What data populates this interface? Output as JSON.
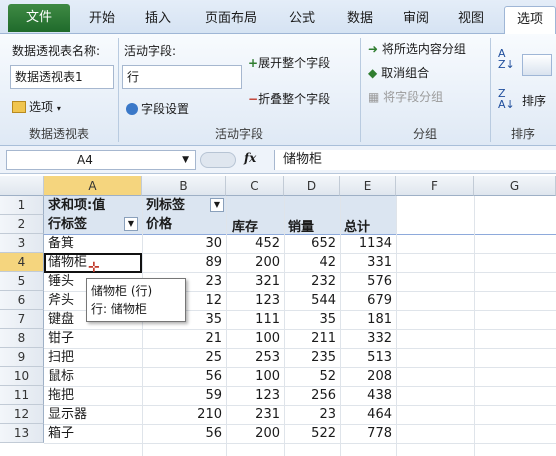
{
  "tabs": [
    "文件",
    "开始",
    "插入",
    "页面布局",
    "公式",
    "数据",
    "审阅",
    "视图",
    "选项"
  ],
  "ribbon": {
    "pivot_group": {
      "name_label": "数据透视表名称:",
      "name_value": "数据透视表1",
      "options_label": "选项",
      "group_label": "数据透视表"
    },
    "field_group": {
      "field_label": "活动字段:",
      "field_value": "行",
      "field_settings": "字段设置",
      "expand_label": "展开整个字段",
      "collapse_label": "折叠整个字段",
      "group_label": "活动字段"
    },
    "grouping_group": {
      "group_selection": "将所选内容分组",
      "ungroup": "取消组合",
      "group_field": "将字段分组",
      "group_label": "分组"
    },
    "sort_group": {
      "sort_label": "排序",
      "group_label": "排序"
    }
  },
  "formula_bar": {
    "cell_ref": "A4",
    "fx": "fx",
    "content": "储物柜"
  },
  "columns": [
    "A",
    "B",
    "C",
    "D",
    "E",
    "F",
    "G"
  ],
  "rows": [
    {
      "n": "1",
      "a": "求和项:值",
      "b": "列标签",
      "c": "",
      "d": "",
      "e": ""
    },
    {
      "n": "2",
      "a": "行标签",
      "b": "价格",
      "c": "库存",
      "d": "销量",
      "e": "总计"
    },
    {
      "n": "3",
      "a": "备箕",
      "b": "30",
      "c": "452",
      "d": "652",
      "e": "1134"
    },
    {
      "n": "4",
      "a": "储物柜",
      "b": "89",
      "c": "200",
      "d": "42",
      "e": "331"
    },
    {
      "n": "5",
      "a": "锤头",
      "b": "23",
      "c": "321",
      "d": "232",
      "e": "576"
    },
    {
      "n": "6",
      "a": "斧头",
      "b": "12",
      "c": "123",
      "d": "544",
      "e": "679"
    },
    {
      "n": "7",
      "a": "键盘",
      "b": "35",
      "c": "111",
      "d": "35",
      "e": "181"
    },
    {
      "n": "8",
      "a": "钳子",
      "b": "21",
      "c": "100",
      "d": "211",
      "e": "332"
    },
    {
      "n": "9",
      "a": "扫把",
      "b": "25",
      "c": "253",
      "d": "235",
      "e": "513"
    },
    {
      "n": "10",
      "a": "鼠标",
      "b": "56",
      "c": "100",
      "d": "52",
      "e": "208"
    },
    {
      "n": "11",
      "a": "拖把",
      "b": "59",
      "c": "123",
      "d": "256",
      "e": "438"
    },
    {
      "n": "12",
      "a": "显示器",
      "b": "210",
      "c": "231",
      "d": "23",
      "e": "464"
    },
    {
      "n": "13",
      "a": "箱子",
      "b": "56",
      "c": "200",
      "d": "522",
      "e": "778"
    }
  ],
  "tooltip": {
    "line1": "储物柜 (行)",
    "line2": "行: 储物柜"
  }
}
